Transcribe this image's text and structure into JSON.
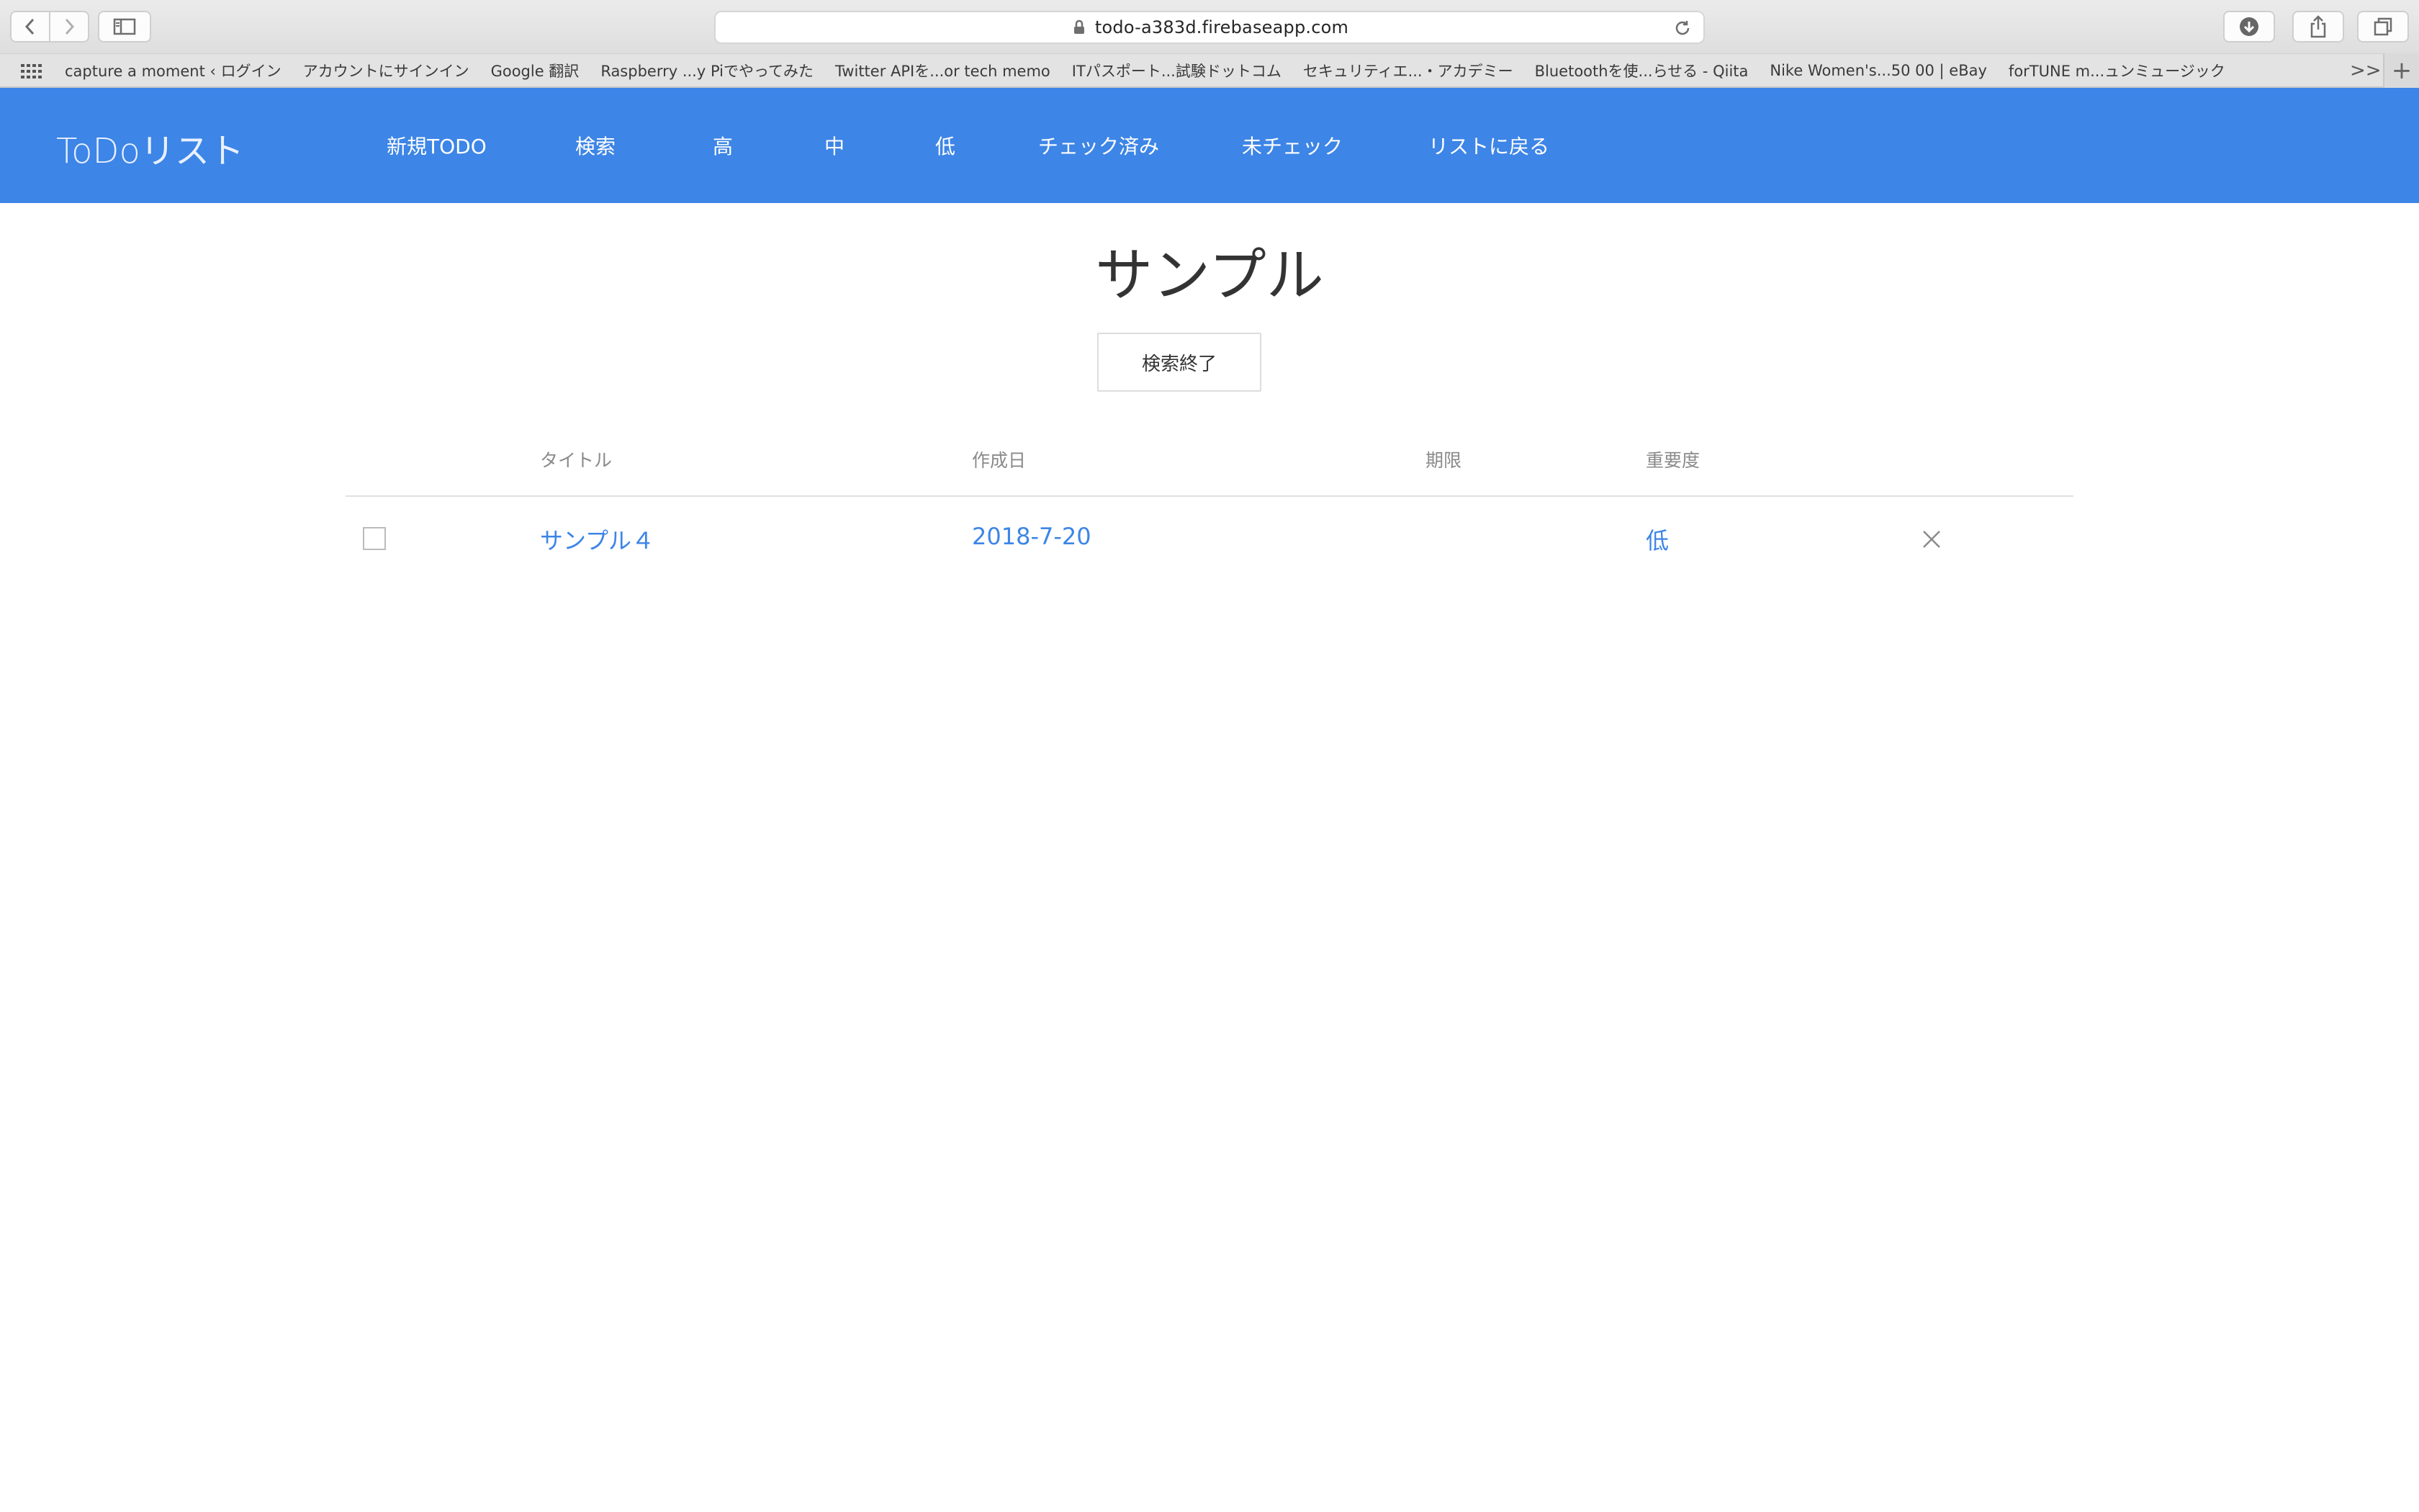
{
  "browser": {
    "url": "todo-a383d.firebaseapp.com",
    "bookmarks": [
      "capture a moment ‹ ログイン",
      "アカウントにサインイン",
      "Google 翻訳",
      "Raspberry ...y Piでやってみた",
      "Twitter APIを...or tech memo",
      "ITパスポート...試験ドットコム",
      "セキュリティエ...・アカデミー",
      "Bluetoothを使...らせる - Qiita",
      "Nike Women's...50 00 | eBay",
      "forTUNE m...ュンミュージック"
    ],
    "more_label": ">>",
    "new_tab_label": "+"
  },
  "app": {
    "brand": "ToDoリスト",
    "menu": [
      "新規TODO",
      "検索",
      "高",
      "中",
      "低",
      "チェック済み",
      "未チェック",
      "リストに戻る"
    ]
  },
  "main": {
    "title": "サンプル",
    "end_search_label": "検索終了",
    "columns": {
      "title": "タイトル",
      "created": "作成日",
      "deadline": "期限",
      "priority": "重要度"
    },
    "rows": [
      {
        "checked": false,
        "title": "サンプル４",
        "created": "2018-7-20",
        "deadline": "",
        "priority": "低"
      }
    ]
  },
  "colors": {
    "accent": "#3d85e6",
    "appbar": "#3d85e6"
  }
}
